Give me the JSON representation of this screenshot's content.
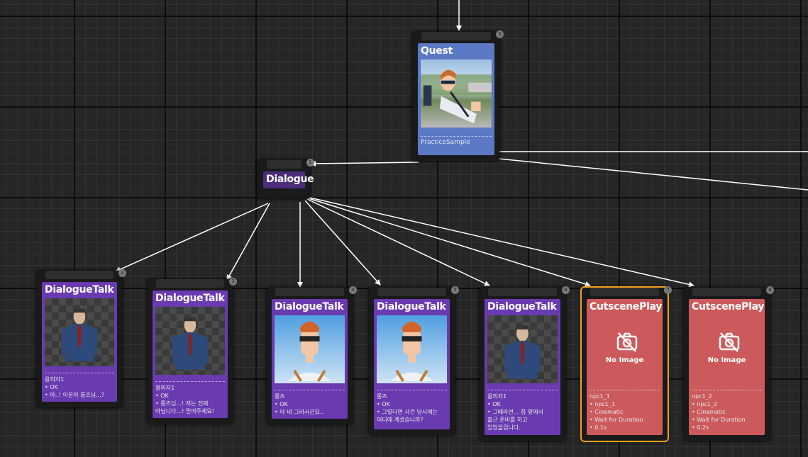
{
  "quest": {
    "title": "Quest",
    "footer": "PracticeSample",
    "index": "0"
  },
  "dialogue": {
    "title": "Dialogue",
    "index": "1"
  },
  "talks": [
    {
      "title": "DialogueTalk",
      "index": "2",
      "speaker": "용의자1",
      "lines": [
        "• OK",
        "• 아..! 이분이 롱즈님...?"
      ]
    },
    {
      "title": "DialogueTalk",
      "index": "3",
      "speaker": "용의자1",
      "lines": [
        "• OK",
        "• 롱즈님...! 저는 진짜",
        "아닙니다...! 믿어주세요!"
      ]
    },
    {
      "title": "DialogueTalk",
      "index": "4",
      "speaker": "롱즈",
      "lines": [
        "• OK",
        "• 아 네 그러시군요.."
      ]
    },
    {
      "title": "DialogueTalk",
      "index": "5",
      "speaker": "롱즈",
      "lines": [
        "• OK",
        "• 그렇다면 사건 당시에는",
        "어디에 계셨습니까?"
      ]
    },
    {
      "title": "DialogueTalk",
      "index": "6",
      "speaker": "용의자1",
      "lines": [
        "• OK",
        "• 그때라면... 집 앞에서",
        "출근 준비를 하고",
        "있었을겁니다."
      ]
    }
  ],
  "cutscenes": [
    {
      "title": "CutscenePlay",
      "index": "7",
      "noimage": "No Image",
      "name": "npc1_1",
      "lines": [
        "• npc1_1",
        "• Cinematic",
        "• Wait for Duration",
        "• 0.1s"
      ]
    },
    {
      "title": "CutscenePlay",
      "index": "8",
      "noimage": "No Image",
      "name": "npc1_2",
      "lines": [
        "• npc1_2",
        "• Cinematic",
        "• Wait for Duration",
        "• 0.2s"
      ]
    }
  ],
  "colors": {
    "purple": "#6a3bb0",
    "red": "#cc5a5c",
    "blue": "#5b79c4",
    "selection": "#f0a21a",
    "wire": "#ffffff"
  },
  "icons": {
    "no_image": "camera-off-icon"
  }
}
